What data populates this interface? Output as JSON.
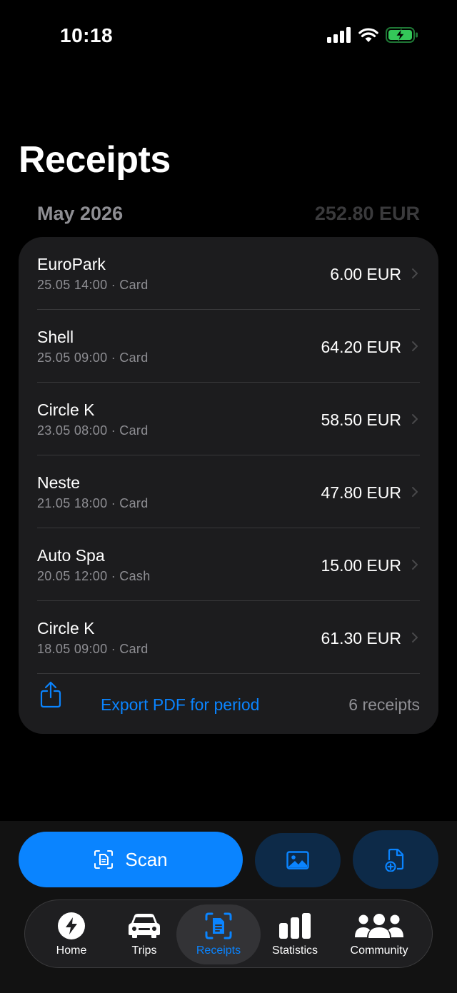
{
  "status_bar": {
    "time": "10:18"
  },
  "page": {
    "title": "Receipts"
  },
  "period": {
    "month": "May 2026",
    "total": "252.80 EUR"
  },
  "receipts": [
    {
      "merchant": "EuroPark",
      "meta": "25.05 14:00 · Card",
      "amount": "6.00 EUR"
    },
    {
      "merchant": "Shell",
      "meta": "25.05 09:00 · Card",
      "amount": "64.20 EUR"
    },
    {
      "merchant": "Circle K",
      "meta": "23.05 08:00 · Card",
      "amount": "58.50 EUR"
    },
    {
      "merchant": "Neste",
      "meta": "21.05 18:00 · Card",
      "amount": "47.80 EUR"
    },
    {
      "merchant": "Auto Spa",
      "meta": "20.05 12:00 · Cash",
      "amount": "15.00 EUR"
    },
    {
      "merchant": "Circle K",
      "meta": "18.05 09:00 · Card",
      "amount": "61.30 EUR"
    }
  ],
  "export": {
    "label": "Export PDF for period",
    "count": "6 receipts",
    "icon": "share-icon"
  },
  "actions": {
    "scan_label": "Scan",
    "scan_icon": "document-scan-icon",
    "photo_icon": "image-icon",
    "file_icon": "add-file-icon"
  },
  "tabs": [
    {
      "label": "Home",
      "icon": "bolt-icon"
    },
    {
      "label": "Trips",
      "icon": "car-icon"
    },
    {
      "label": "Receipts",
      "icon": "receipt-scan-icon",
      "active": true
    },
    {
      "label": "Statistics",
      "icon": "bar-chart-icon"
    },
    {
      "label": "Community",
      "icon": "people-icon"
    }
  ],
  "colors": {
    "accent": "#0a84ff",
    "card": "#1c1c1e",
    "background": "#000000",
    "battery": "#34c759"
  }
}
